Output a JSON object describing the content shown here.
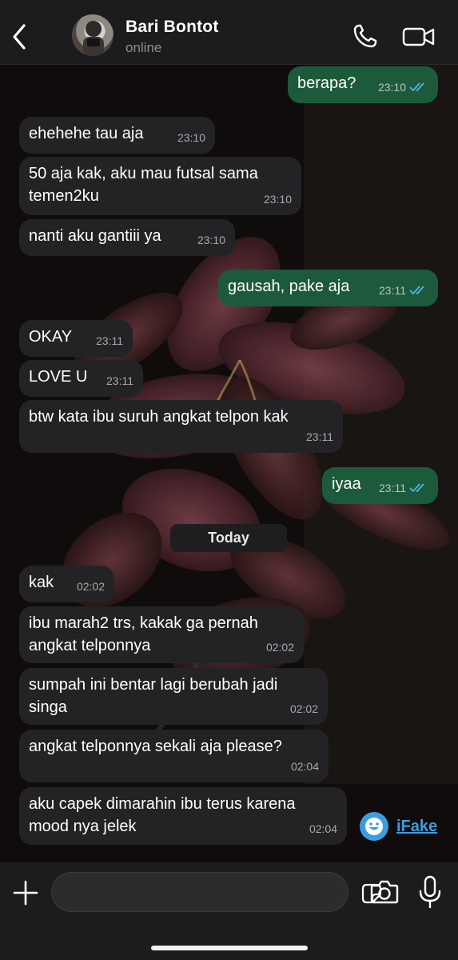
{
  "header": {
    "contact_name": "Bari Bontot",
    "status": "online"
  },
  "messages": [
    {
      "text": "berapa?",
      "time": "23:10",
      "direction": "out"
    },
    {
      "text": "ehehehe tau aja",
      "time": "23:10",
      "direction": "in"
    },
    {
      "text": "50 aja kak, aku mau futsal sama temen2ku",
      "time": "23:10",
      "direction": "in"
    },
    {
      "text": "nanti aku gantiii ya",
      "time": "23:10",
      "direction": "in"
    },
    {
      "text": "gausah, pake aja",
      "time": "23:11",
      "direction": "out"
    },
    {
      "text": "OKAY",
      "time": "23:11",
      "direction": "in"
    },
    {
      "text": "LOVE U",
      "time": "23:11",
      "direction": "in"
    },
    {
      "text": "btw kata ibu suruh angkat telpon kak",
      "time": "23:11",
      "direction": "in"
    },
    {
      "text": "iyaa",
      "time": "23:11",
      "direction": "out"
    },
    {
      "text": "kak",
      "time": "02:02",
      "direction": "in"
    },
    {
      "text": "ibu marah2 trs, kakak ga pernah angkat telponnya",
      "time": "02:02",
      "direction": "in"
    },
    {
      "text": "sumpah ini bentar lagi berubah jadi singa",
      "time": "02:02",
      "direction": "in"
    },
    {
      "text": "angkat telponnya sekali aja please?",
      "time": "02:04",
      "direction": "in"
    },
    {
      "text": "aku capek dimarahin ibu terus karena mood nya jelek",
      "time": "02:04",
      "direction": "in"
    }
  ],
  "date_divider": "Today",
  "watermark": "iFake",
  "colors": {
    "incoming_bubble": "#232326",
    "outgoing_bubble": "#1d5a3b",
    "read_ticks": "#4fb6ec",
    "bar_background": "#1c1c1e"
  },
  "icons": [
    "back-arrow-icon",
    "phone-icon",
    "video-camera-icon",
    "plus-icon",
    "sticker-icon",
    "camera-icon",
    "microphone-icon",
    "double-check-icon"
  ]
}
